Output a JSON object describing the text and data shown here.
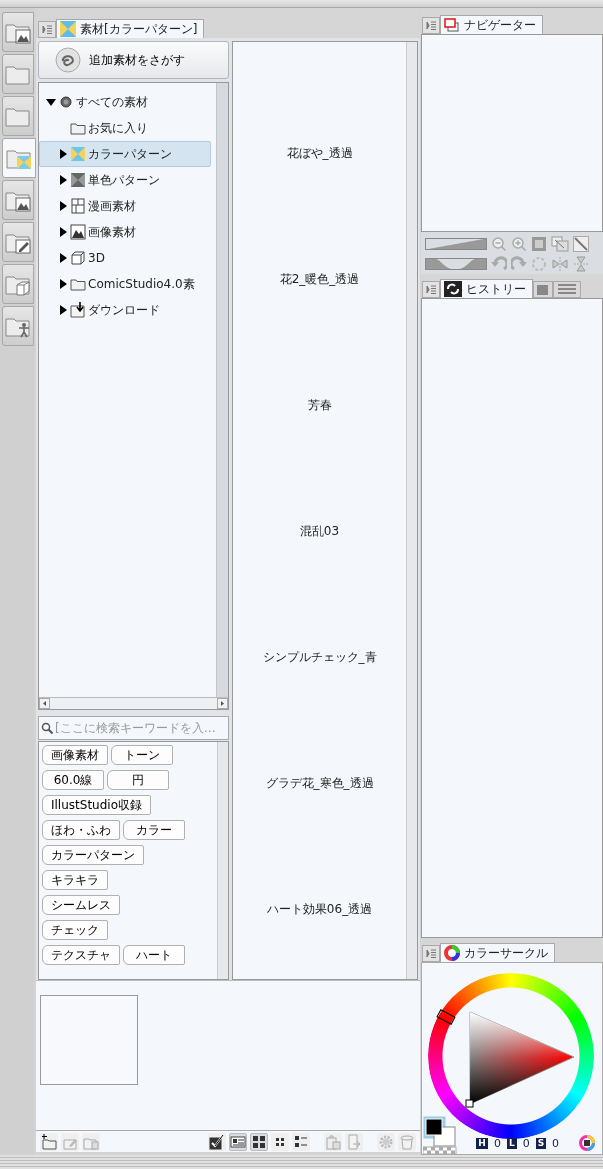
{
  "left_rail": {
    "tabs": [
      {
        "kind": "image-folder",
        "selected": false
      },
      {
        "kind": "folder",
        "selected": false
      },
      {
        "kind": "folder",
        "selected": false
      },
      {
        "kind": "pattern-folder",
        "selected": true
      },
      {
        "kind": "image-folder",
        "selected": false
      },
      {
        "kind": "pencil-folder",
        "selected": false
      },
      {
        "kind": "cube-folder",
        "selected": false
      },
      {
        "kind": "figure-folder",
        "selected": false
      }
    ]
  },
  "material_panel": {
    "tab": {
      "title": "素材[カラーパターン]"
    },
    "find_button": "追加素材をさがす",
    "tree": [
      {
        "label": "すべての素材",
        "kind": "all",
        "expanded": true,
        "selected": false,
        "children": [
          {
            "label": "お気に入り",
            "kind": "folder",
            "selected": false
          },
          {
            "label": "カラーパターン",
            "kind": "pattern",
            "expanded": false,
            "selected": true
          },
          {
            "label": "単色パターン",
            "kind": "mono-pattern",
            "expanded": false,
            "selected": false
          },
          {
            "label": "漫画素材",
            "kind": "manga",
            "expanded": false,
            "selected": false
          },
          {
            "label": "画像素材",
            "kind": "image",
            "expanded": false,
            "selected": false
          },
          {
            "label": "3D",
            "kind": "cube",
            "expanded": false,
            "selected": false
          },
          {
            "label": "ComicStudio4.0素",
            "kind": "folder",
            "expanded": false,
            "selected": false
          },
          {
            "label": "ダウンロード",
            "kind": "download",
            "expanded": false,
            "selected": false
          }
        ]
      }
    ],
    "search": {
      "placeholder": "[ここに検索キーワードを入…"
    },
    "tag_rows": [
      [
        "画像素材",
        "トーン"
      ],
      [
        "60.0線",
        "円"
      ],
      [
        "IllustStudio収録"
      ],
      [
        "ほわ・ふわ",
        "カラー"
      ],
      [
        "カラーパターン"
      ],
      [
        "キラキラ"
      ],
      [
        "シームレス"
      ],
      [
        "チェック"
      ],
      [
        "テクスチャ",
        "ハート"
      ]
    ],
    "materials": [
      "花ぼや_透過",
      "花2_暖色_透過",
      "芳春",
      "混乱03",
      "シンプルチェック_青",
      "グラデ花_寒色_透過",
      "ハート効果06_透過"
    ],
    "show_checkbox": {
      "checked": true
    },
    "view_modes": [
      {
        "kind": "detail",
        "selected": true
      },
      {
        "kind": "large",
        "selected": true
      },
      {
        "kind": "small",
        "selected": false
      },
      {
        "kind": "list",
        "selected": false
      }
    ]
  },
  "navigator": {
    "tab": "ナビゲーター"
  },
  "history": {
    "tab": "ヒストリー"
  },
  "color_circle": {
    "tab": "カラーサークル",
    "hls": [
      {
        "key": "H",
        "value": "0"
      },
      {
        "key": "L",
        "value": "0"
      },
      {
        "key": "S",
        "value": "0"
      }
    ]
  }
}
